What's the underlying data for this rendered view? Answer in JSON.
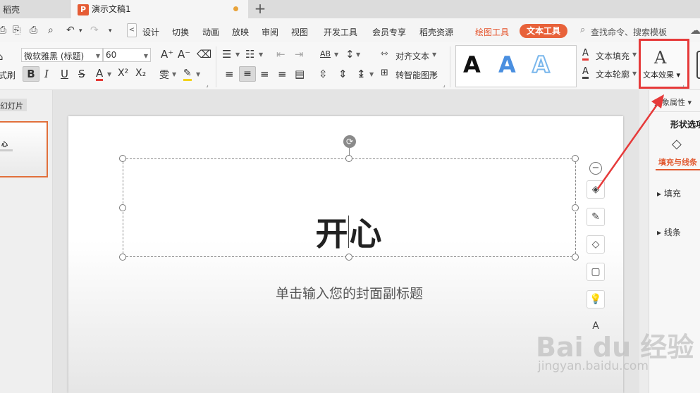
{
  "tabs": {
    "home": "稻壳",
    "doc": "演示文稿1",
    "ppt_logo": "P",
    "new_tab": "+"
  },
  "menu": {
    "quick": [
      "⎙",
      "⎘",
      "⎙",
      "⌕",
      "↶",
      "▾",
      "↷",
      "▾"
    ],
    "back": "<",
    "items": [
      "设计",
      "切换",
      "动画",
      "放映",
      "审阅",
      "视图",
      "开发工具",
      "会员专享",
      "稻壳资源"
    ],
    "drawing_tool": "绘图工具",
    "text_tool": "文本工具",
    "search": "查找命令、搜索模板"
  },
  "ribbon": {
    "brush_label": "式刷",
    "font_name": "微软雅黑 (标题)",
    "font_size": "60",
    "grow": "A⁺",
    "shrink": "A⁻",
    "clear": "⌫",
    "bold": "B",
    "italic": "I",
    "underline": "U",
    "strike": "S",
    "font_color": "A",
    "superscript": "X²",
    "subscript": "X₂",
    "phonetic": "雯",
    "highlight": "✎",
    "bullets": "☰",
    "numbering": "☷",
    "dec_indent": "⇤",
    "inc_indent": "⇥",
    "text_dir_ab": "AB",
    "sort": "↕",
    "align_left": "≡",
    "align_center": "≡",
    "align_right": "≡",
    "justify": "≡",
    "distribute": "▤",
    "line_spacing": "⇳",
    "para_spacing": "⇕",
    "col_spacing": "↨",
    "align_text": "对齐文本",
    "convert_smartart": "转智能图形",
    "styles": [
      "A",
      "A",
      "A"
    ],
    "text_fill": "文本填充",
    "text_outline": "文本轮廓",
    "text_effect": "文本效果"
  },
  "left_panel": {
    "tab": "幻灯片",
    "thumb_title": "心"
  },
  "slide": {
    "title": "开心",
    "subtitle": "单击输入您的封面副标题"
  },
  "right_panel": {
    "object_props": "对象属性",
    "shape_options": "形状选项",
    "fill_and_line": "填充与线条",
    "fill": "填充",
    "line": "线条"
  },
  "watermark": {
    "brand": "Bai du 经验",
    "url": "jingyan.baidu.com"
  },
  "colors": {
    "accent": "#e8623a",
    "highlight_box": "#e63a3a",
    "style_blue": "#4a8fe0",
    "style_outline": "#7ab7ec"
  },
  "icons": {
    "layers": "layers-icon",
    "brush": "brush-icon",
    "fill": "paint-bucket-icon",
    "border": "frame-icon",
    "idea": "lightbulb-icon",
    "typeset": "typesetting-icon"
  }
}
